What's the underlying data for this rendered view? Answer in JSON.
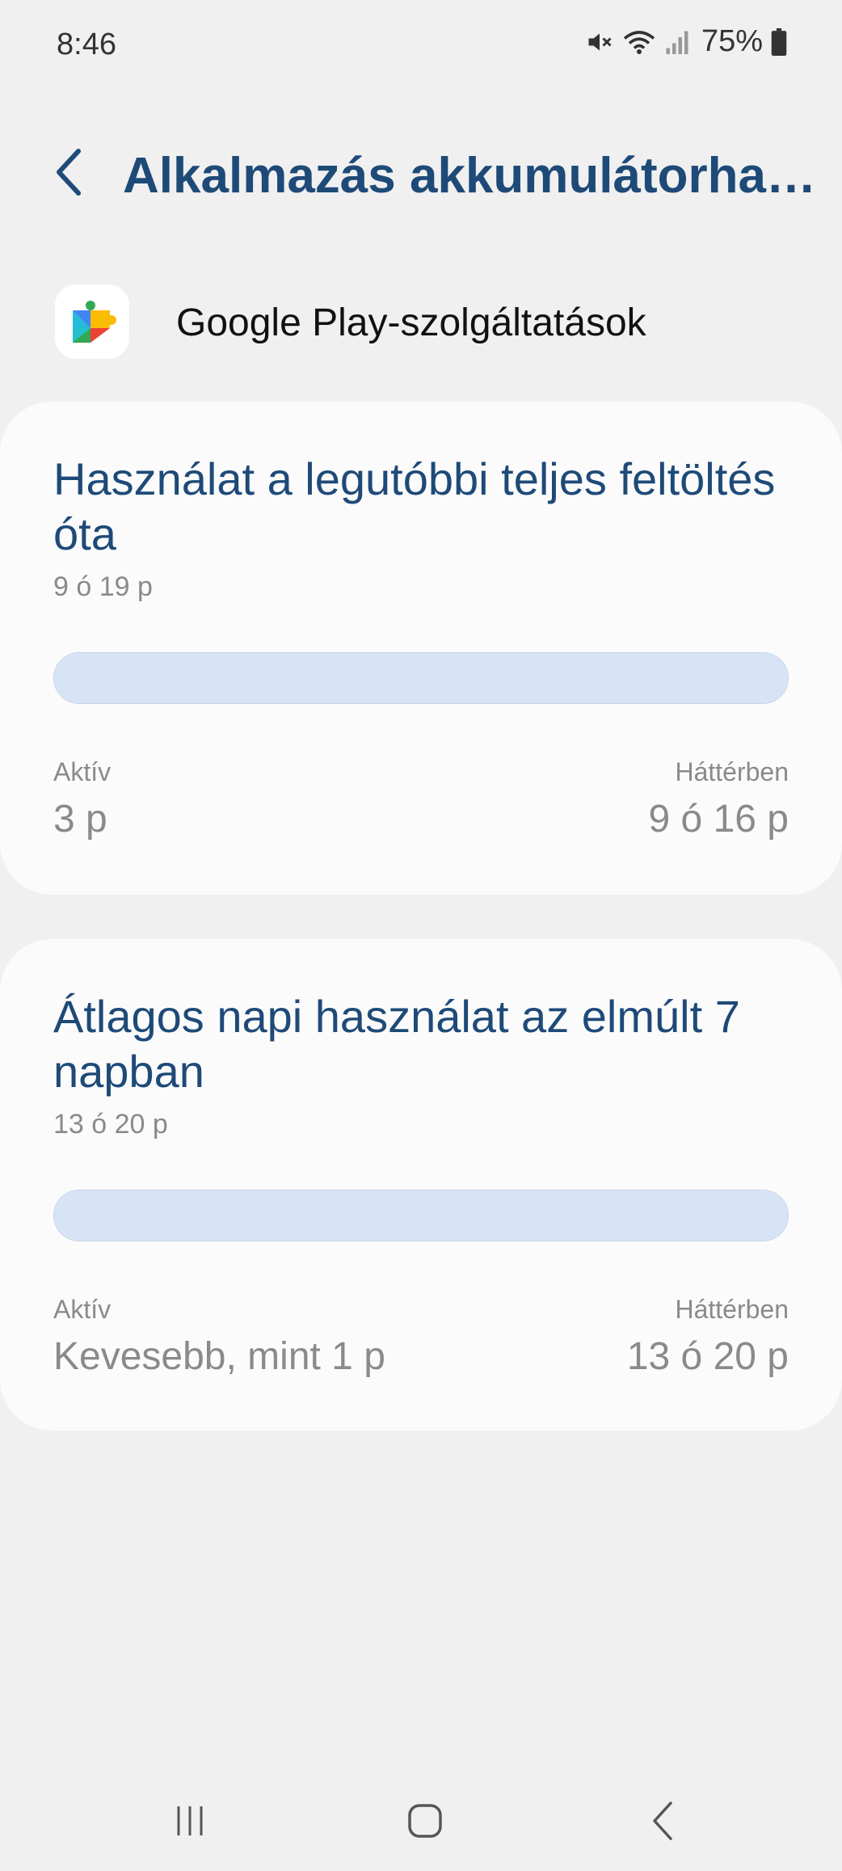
{
  "status_bar": {
    "time": "8:46",
    "battery_percent": "75%",
    "icons": [
      "mute-icon",
      "wifi-icon",
      "signal-icon",
      "battery-icon"
    ]
  },
  "header": {
    "back_icon": "chevron-left-icon",
    "title": "Alkalmazás akkumulátorhasz…"
  },
  "app": {
    "icon": "google-play-services-icon",
    "name": "Google Play-szolgáltatások"
  },
  "cards": [
    {
      "title": "Használat a legutóbbi teljes feltöltés óta",
      "total": "9 ó 19 p",
      "bar_fill_percent": 100,
      "active_label": "Aktív",
      "active_value": "3 p",
      "background_label": "Háttérben",
      "background_value": "9 ó 16 p"
    },
    {
      "title": "Átlagos napi használat az elmúlt 7 napban",
      "total": "13 ó 20 p",
      "bar_fill_percent": 100,
      "active_label": "Aktív",
      "active_value": "Kevesebb, mint 1 p",
      "background_label": "Háttérben",
      "background_value": "13 ó 20 p"
    }
  ],
  "nav_bar": {
    "items": [
      "recents-icon",
      "home-icon",
      "back-icon"
    ]
  },
  "colors": {
    "title_blue": "#1e4a78",
    "bar_fill": "#d6e4f5",
    "background": "#f0f0f0",
    "card": "#fbfbfb"
  }
}
